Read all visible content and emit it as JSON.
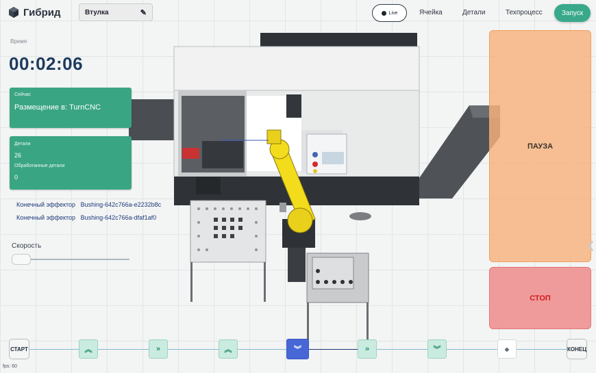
{
  "app": {
    "name": "Гибрид"
  },
  "header": {
    "part_name": "Втулка",
    "live_label": "Live",
    "nav": [
      "Ячейка",
      "Детали",
      "Техпроцесс"
    ],
    "start_label": "Запуск"
  },
  "timer": {
    "label": "Время",
    "value": "00:02:06"
  },
  "current": {
    "label": "Сейчас",
    "value": "Размещение в: TurnCNC"
  },
  "parts": {
    "label": "Детали",
    "count": "26",
    "processed_label": "Обработанные детали",
    "processed": "0"
  },
  "effectors": [
    {
      "label": "Конечный эффектор",
      "value": "Bushing-642c766a-e2232b8c"
    },
    {
      "label": "Конечный эффектор",
      "value": "Bushing-642c766a-dfaf1af0"
    }
  ],
  "speed": {
    "label": "Скорость",
    "value": 0
  },
  "controls": {
    "pause_label": "ПАУЗА",
    "stop_label": "СТОП"
  },
  "timeline": {
    "start_label": "СТАРТ",
    "end_label": "КОНЕЦ",
    "nodes": [
      {
        "icon": "double-chevron-up-icon",
        "glyph": "︽"
      },
      {
        "icon": "double-chevron-right-icon",
        "glyph": "»"
      },
      {
        "icon": "double-chevron-up-icon",
        "glyph": "︽"
      },
      {
        "icon": "double-chevron-down-icon",
        "glyph": "︾",
        "active": true
      },
      {
        "icon": "double-chevron-right-icon",
        "glyph": "»"
      },
      {
        "icon": "double-chevron-down-icon",
        "glyph": "︾"
      },
      {
        "icon": "diamond-icon",
        "glyph": "◆"
      }
    ]
  },
  "fps": "fps: 60",
  "colors": {
    "accent": "#3aa583",
    "pause": "#f7b27c",
    "stop": "#ef8b8b",
    "active_step": "#4867d6",
    "robot": "#f2dc1c"
  }
}
